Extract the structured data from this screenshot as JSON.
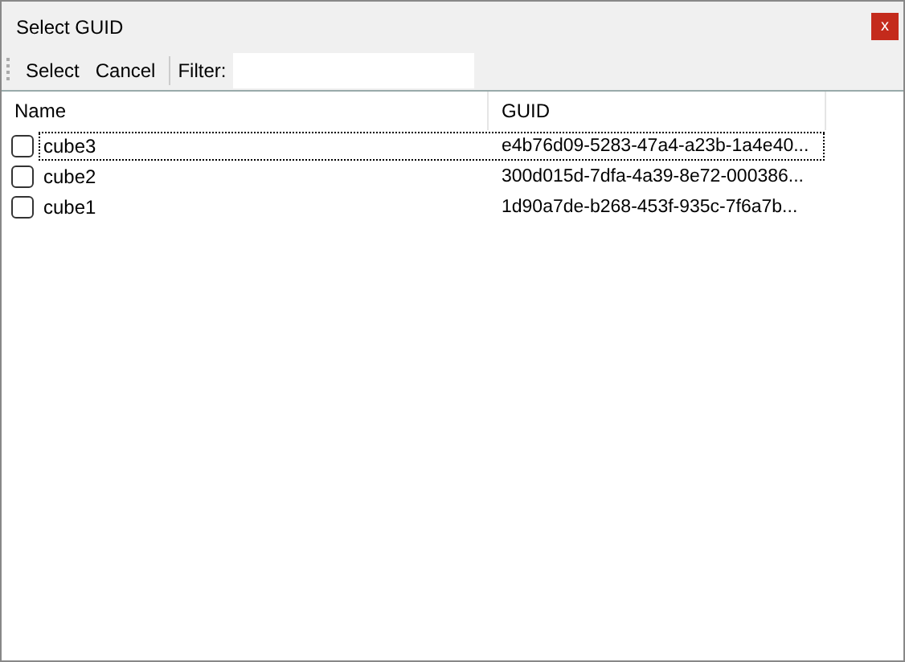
{
  "window": {
    "title": "Select GUID",
    "close": "x"
  },
  "toolbar": {
    "buttons": [
      "Select",
      "Cancel"
    ],
    "filter_label": "Filter:"
  },
  "table": {
    "columns": [
      "Name",
      "GUID"
    ],
    "rows": [
      {
        "name": "cube3",
        "guid": "e4b76d09-5283-47a4-a23b-1a4e40...",
        "checked": false,
        "selected": true
      },
      {
        "name": "cube2",
        "guid": "300d015d-7dfa-4a39-8e72-000386...",
        "checked": false,
        "selected": false
      },
      {
        "name": "cube1",
        "guid": "1d90a7de-b268-453f-935c-7f6a7b...",
        "checked": false,
        "selected": false
      }
    ]
  }
}
